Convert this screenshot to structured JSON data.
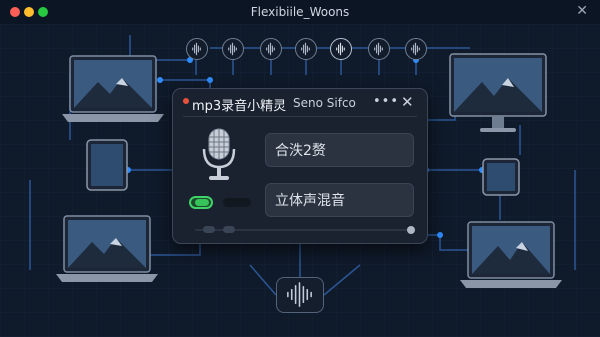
{
  "window": {
    "title": "Flexibiile_Woons"
  },
  "app": {
    "title": "mp3录音小精灵",
    "subtitle": "Seno Sifco",
    "menu_icon": "more-icon",
    "close_icon": "close-icon",
    "buttons": [
      {
        "label": "合泆2赘"
      },
      {
        "label": "立体声混音"
      }
    ],
    "toggle_on": true
  },
  "colors": {
    "background": "#0f1a2a",
    "panel": "#1a2230",
    "node_blue": "#2f8cff",
    "toggle_green": "#3fd36a",
    "line_blue": "#3f78c7"
  }
}
